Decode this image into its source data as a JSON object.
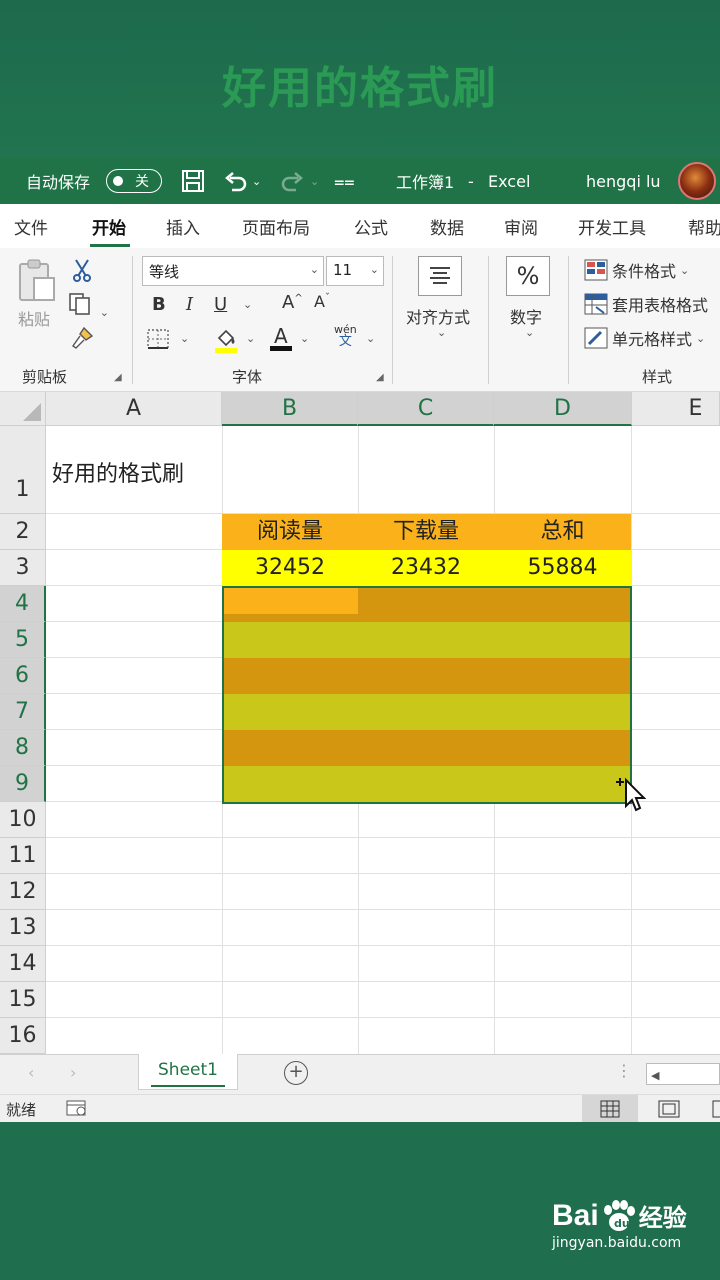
{
  "banner": {
    "title": "好用的格式刷"
  },
  "titlebar": {
    "autosave_label": "自动保存",
    "autosave_state": "关",
    "workbook_title": "工作簿1",
    "separator": "-",
    "app_name": "Excel",
    "user_name": "hengqi lu"
  },
  "tabs": [
    "文件",
    "开始",
    "插入",
    "页面布局",
    "公式",
    "数据",
    "审阅",
    "开发工具",
    "帮助"
  ],
  "ribbon": {
    "clipboard": {
      "paste": "粘贴",
      "group": "剪贴板"
    },
    "font": {
      "name": "等线",
      "size": "11",
      "bold": "B",
      "italic": "I",
      "underline": "U",
      "grow": "A",
      "shrink": "A",
      "phonetic_top": "wén",
      "phonetic_bottom": "文",
      "group": "字体"
    },
    "alignment": {
      "label": "对齐方式"
    },
    "number": {
      "symbol": "%",
      "label": "数字"
    },
    "styles": {
      "conditional": "条件格式",
      "table": "套用表格格式",
      "cell": "单元格样式",
      "group": "样式"
    }
  },
  "grid": {
    "columns": [
      "A",
      "B",
      "C",
      "D",
      "E"
    ],
    "rows": [
      "1",
      "2",
      "3",
      "4",
      "5",
      "6",
      "7",
      "8",
      "9",
      "10",
      "11",
      "12",
      "13",
      "14",
      "15",
      "16"
    ],
    "a1": "好用的格式刷",
    "headers": [
      "阅读量",
      "下载量",
      "总和"
    ],
    "values": [
      "32452",
      "23432",
      "55884"
    ]
  },
  "colors": {
    "excel_green": "#217346",
    "header_fill": "#fbb21a",
    "value_fill": "#ffff00",
    "band_dark": "#d4960f",
    "band_light": "#c9c81a",
    "band_first": "#fbb21a"
  },
  "sheets": {
    "active": "Sheet1"
  },
  "status": {
    "ready": "就绪"
  },
  "watermark": {
    "brand": "Bai",
    "brand2": "经验",
    "url": "jingyan.baidu.com"
  }
}
